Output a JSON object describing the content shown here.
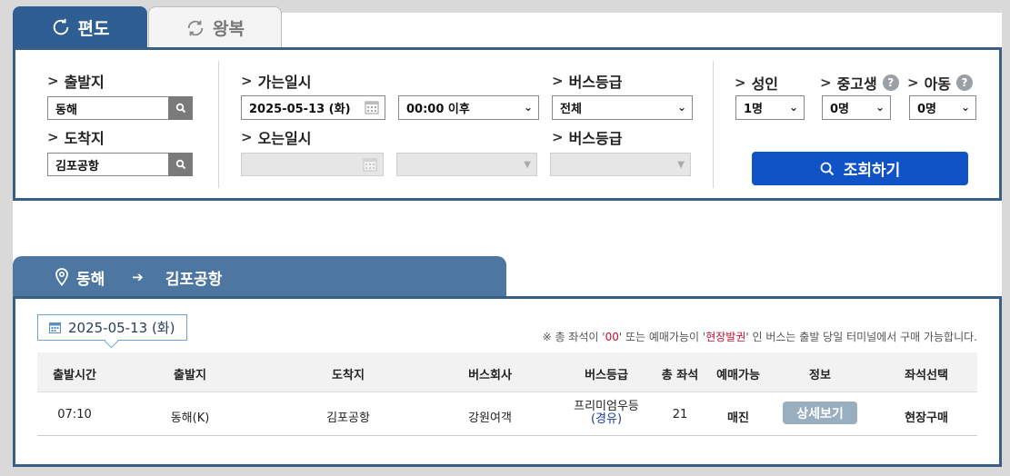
{
  "tabs": {
    "oneway": "편도",
    "roundtrip": "왕복"
  },
  "search": {
    "departure_label": "출발지",
    "departure_value": "동해",
    "arrival_label": "도착지",
    "arrival_value": "김포공항",
    "go_date_label": "가는일시",
    "go_date_value": "2025-05-13 (화)",
    "go_time_value": "00:00 이후",
    "return_date_label": "오는일시",
    "bus_grade_label": "버스등급",
    "bus_grade_value": "전체",
    "bus_grade_label2": "버스등급",
    "adult_label": "성인",
    "adult_value": "1명",
    "teen_label": "중고생",
    "teen_value": "0명",
    "child_label": "아동",
    "child_value": "0명",
    "query_button": "조회하기"
  },
  "route": {
    "from": "동해",
    "to": "김포공항"
  },
  "results": {
    "date_badge": "2025-05-13 (화)",
    "notice_prefix": "※ 총 좌석이 '",
    "notice_red1": "00",
    "notice_mid": "' 또는 예매가능이 '",
    "notice_red2": "현장발권",
    "notice_suffix": "' 인 버스는 출발 당일 터미널에서 구매 가능합니다.",
    "headers": [
      "출발시간",
      "출발지",
      "도착지",
      "버스회사",
      "버스등급",
      "총 좌석",
      "예매가능",
      "정보",
      "좌석선택"
    ],
    "rows": [
      {
        "time": "07:10",
        "from": "동해(K)",
        "to": "김포공항",
        "company": "강원여객",
        "grade": "프리미엄우등",
        "grade_sub": "(경유)",
        "seats": "21",
        "status": "매진",
        "info_button": "상세보기",
        "select": "현장구매"
      }
    ]
  },
  "colors": {
    "primary": "#2f5f92",
    "button": "#1053c7",
    "border": "#3a5f86",
    "route_tab": "#4d77a0",
    "notice_red": "#c8102e"
  }
}
